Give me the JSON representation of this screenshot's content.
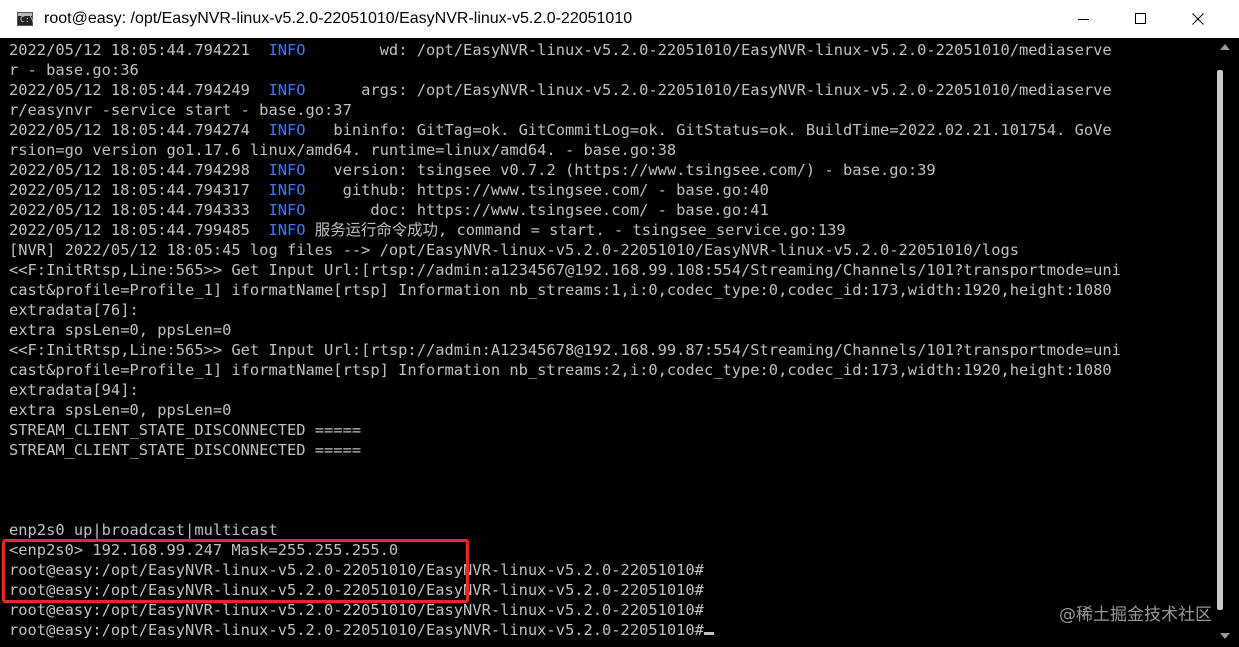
{
  "window": {
    "title": "root@easy: /opt/EasyNVR-linux-v5.2.0-22051010/EasyNVR-linux-v5.2.0-22051010",
    "icon": "C:\\",
    "controls": [
      "minimize-icon",
      "maximize-icon",
      "close-icon"
    ]
  },
  "terminal": {
    "colors": {
      "text": "#c0c0c0",
      "info": "#3b78ff",
      "background": "#000000",
      "highlight_box": "#e5262a"
    },
    "lines": [
      {
        "pre": "2022/05/12 18:05:44.794221  ",
        "level": "INFO",
        "post": "        wd: /opt/EasyNVR-linux-v5.2.0-22051010/EasyNVR-linux-v5.2.0-22051010/mediaserve"
      },
      {
        "pre": "r - base.go:36",
        "level": "",
        "post": ""
      },
      {
        "pre": "2022/05/12 18:05:44.794249  ",
        "level": "INFO",
        "post": "      args: /opt/EasyNVR-linux-v5.2.0-22051010/EasyNVR-linux-v5.2.0-22051010/mediaserve"
      },
      {
        "pre": "r/easynvr -service start - base.go:37",
        "level": "",
        "post": ""
      },
      {
        "pre": "2022/05/12 18:05:44.794274  ",
        "level": "INFO",
        "post": "   bininfo: GitTag=ok. GitCommitLog=ok. GitStatus=ok. BuildTime=2022.02.21.101754. GoVe"
      },
      {
        "pre": "rsion=go version go1.17.6 linux/amd64. runtime=linux/amd64. - base.go:38",
        "level": "",
        "post": ""
      },
      {
        "pre": "2022/05/12 18:05:44.794298  ",
        "level": "INFO",
        "post": "   version: tsingsee v0.7.2 (https://www.tsingsee.com/) - base.go:39"
      },
      {
        "pre": "2022/05/12 18:05:44.794317  ",
        "level": "INFO",
        "post": "    github: https://www.tsingsee.com/ - base.go:40"
      },
      {
        "pre": "2022/05/12 18:05:44.794333  ",
        "level": "INFO",
        "post": "       doc: https://www.tsingsee.com/ - base.go:41"
      },
      {
        "pre": "2022/05/12 18:05:44.799485  ",
        "level": "INFO",
        "post": " 服务运行命令成功, command = start. - tsingsee_service.go:139"
      },
      {
        "pre": "[NVR] 2022/05/12 18:05:45 log files --> /opt/EasyNVR-linux-v5.2.0-22051010/EasyNVR-linux-v5.2.0-22051010/logs",
        "level": "",
        "post": ""
      },
      {
        "pre": "<<F:InitRtsp,Line:565>> Get Input Url:[rtsp://admin:a1234567@192.168.99.108:554/Streaming/Channels/101?transportmode=uni",
        "level": "",
        "post": ""
      },
      {
        "pre": "cast&profile=Profile_1] iformatName[rtsp] Information nb_streams:1,i:0,codec_type:0,codec_id:173,width:1920,height:1080",
        "level": "",
        "post": ""
      },
      {
        "pre": "extradata[76]:",
        "level": "",
        "post": ""
      },
      {
        "pre": "extra spsLen=0, ppsLen=0",
        "level": "",
        "post": ""
      },
      {
        "pre": "<<F:InitRtsp,Line:565>> Get Input Url:[rtsp://admin:A12345678@192.168.99.87:554/Streaming/Channels/101?transportmode=uni",
        "level": "",
        "post": ""
      },
      {
        "pre": "cast&profile=Profile_1] iformatName[rtsp] Information nb_streams:2,i:0,codec_type:0,codec_id:173,width:1920,height:1080",
        "level": "",
        "post": ""
      },
      {
        "pre": "extradata[94]:",
        "level": "",
        "post": ""
      },
      {
        "pre": "extra spsLen=0, ppsLen=0",
        "level": "",
        "post": ""
      },
      {
        "pre": "STREAM_CLIENT_STATE_DISCONNECTED =====",
        "level": "",
        "post": ""
      },
      {
        "pre": "STREAM_CLIENT_STATE_DISCONNECTED =====",
        "level": "",
        "post": ""
      },
      {
        "pre": "",
        "level": "",
        "post": ""
      },
      {
        "pre": "",
        "level": "",
        "post": ""
      },
      {
        "pre": "",
        "level": "",
        "post": ""
      },
      {
        "pre": "enp2s0 up|broadcast|multicast",
        "level": "",
        "post": ""
      },
      {
        "pre": "<enp2s0> 192.168.99.247 Mask=255.255.255.0",
        "level": "",
        "post": ""
      },
      {
        "pre": "root@easy:/opt/EasyNVR-linux-v5.2.0-22051010/EasyNVR-linux-v5.2.0-22051010#",
        "level": "",
        "post": ""
      },
      {
        "pre": "root@easy:/opt/EasyNVR-linux-v5.2.0-22051010/EasyNVR-linux-v5.2.0-22051010#",
        "level": "",
        "post": ""
      },
      {
        "pre": "root@easy:/opt/EasyNVR-linux-v5.2.0-22051010/EasyNVR-linux-v5.2.0-22051010#",
        "level": "",
        "post": ""
      },
      {
        "pre": "root@easy:/opt/EasyNVR-linux-v5.2.0-22051010/EasyNVR-linux-v5.2.0-22051010#",
        "level": "",
        "post": ""
      }
    ]
  },
  "watermark": "@稀土掘金技术社区"
}
